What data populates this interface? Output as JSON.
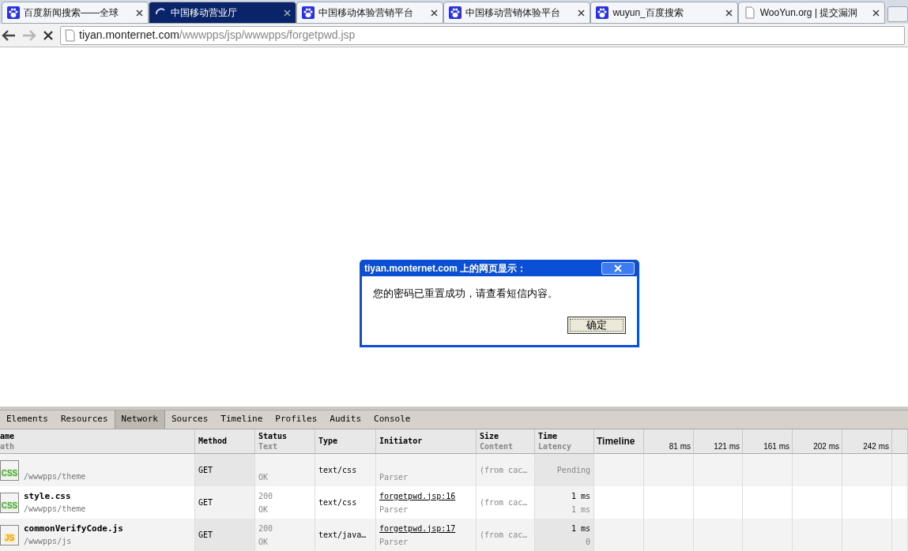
{
  "browser_tabs": [
    {
      "title": "百度新闻搜索——全球",
      "selected": false,
      "kind": "site"
    },
    {
      "title": "中国移动营业厅",
      "selected": true,
      "kind": "loading"
    },
    {
      "title": "中国移动体验营销平台",
      "selected": false,
      "kind": "site"
    },
    {
      "title": "中国移动营销体验平台",
      "selected": false,
      "kind": "site"
    },
    {
      "title": "wuyun_百度搜索",
      "selected": false,
      "kind": "site"
    },
    {
      "title": "WooYun.org | 提交漏洞",
      "selected": false,
      "kind": "blank"
    }
  ],
  "address_bar": {
    "host": "tiyan.monternet.com",
    "path": "/wwwpps/jsp/wwwpps/forgetpwd.jsp",
    "forward_disabled": true
  },
  "dialog": {
    "title": "tiyan.monternet.com 上的网页显示：",
    "message": "您的密码已重置成功，请查看短信内容。",
    "button": "确定"
  },
  "devtools": {
    "tabs": [
      {
        "label": "Elements",
        "selected": false
      },
      {
        "label": "Resources",
        "selected": false
      },
      {
        "label": "Network",
        "selected": true
      },
      {
        "label": "Sources",
        "selected": false
      },
      {
        "label": "Timeline",
        "selected": false
      },
      {
        "label": "Profiles",
        "selected": false
      },
      {
        "label": "Audits",
        "selected": false
      },
      {
        "label": "Console",
        "selected": false
      }
    ],
    "columns": [
      {
        "label": "ame",
        "sub": "ath"
      },
      {
        "label": "Method"
      },
      {
        "label": "Status",
        "sub": "Text"
      },
      {
        "label": "Type"
      },
      {
        "label": "Initiator"
      },
      {
        "label": "Size",
        "sub": "Content"
      },
      {
        "label": "Time",
        "sub": "Latency"
      }
    ],
    "timeline": {
      "label": "Timeline",
      "ticks": [
        "81 ms",
        "121 ms",
        "161 ms",
        "202 ms",
        "242 ms"
      ]
    },
    "rows": [
      {
        "file_label": "CSS",
        "kind": "css",
        "path": "/wwwpps/theme",
        "method": "GET",
        "status_text": "OK",
        "type": "text/css",
        "initiator_kind": "Parser",
        "size": "(from cac…",
        "time": "Pending"
      },
      {
        "file_label": "CSS",
        "kind": "css",
        "name": "style.css",
        "path": "/wwwpps/theme",
        "method": "GET",
        "status": "200",
        "status_text": "OK",
        "type": "text/css",
        "initiator": "forgetpwd.jsp:16",
        "initiator_kind": "Parser",
        "size": "(from cac…",
        "time": "1 ms",
        "latency": "1 ms"
      },
      {
        "file_label": "JS",
        "kind": "js",
        "name": "commonVerifyCode.js",
        "path": "/wwwpps/js",
        "method": "GET",
        "status": "200",
        "status_text": "OK",
        "type": "text/java…",
        "initiator": "forgetpwd.jsp:17",
        "initiator_kind": "Parser",
        "size": "(from cac…",
        "time": "1 ms",
        "latency": "0"
      }
    ]
  }
}
